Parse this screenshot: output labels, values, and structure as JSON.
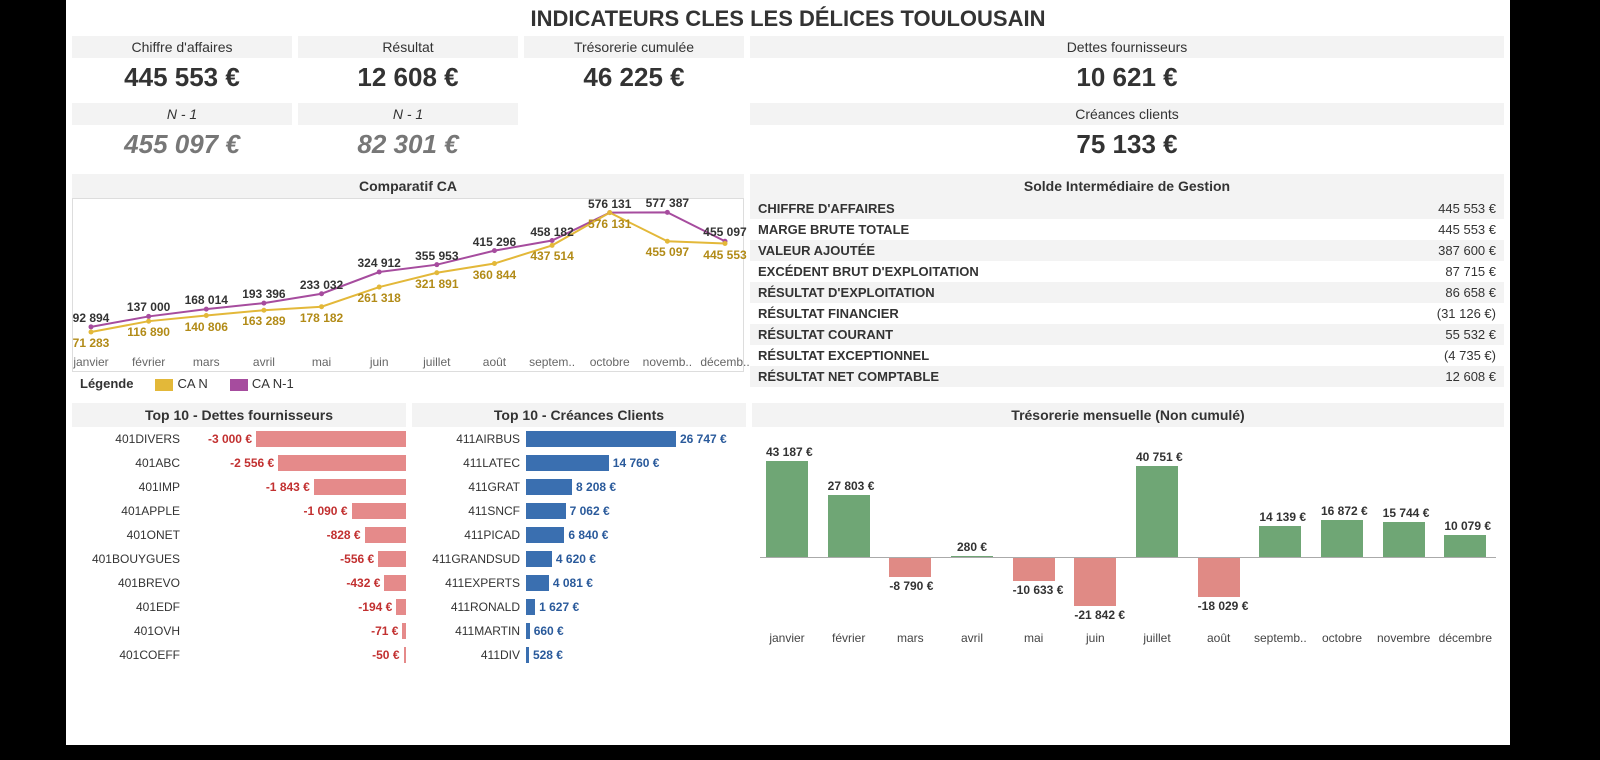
{
  "title": "INDICATEURS CLES LES DÉLICES TOULOUSAIN",
  "kpi_top": [
    {
      "label": "Chiffre d'affaires",
      "value": "445 553 €"
    },
    {
      "label": "Résultat",
      "value": "12 608 €"
    },
    {
      "label": "Trésorerie cumulée",
      "value": "46 225 €"
    },
    {
      "label": "Dettes fournisseurs",
      "value": "10 621 €"
    }
  ],
  "kpi_second": [
    {
      "label": "N - 1",
      "value": "455 097 €"
    },
    {
      "label": "N - 1",
      "value": "82 301 €"
    },
    {
      "label": "Créances clients",
      "value": "75 133 €"
    }
  ],
  "legend": {
    "title": "Légende",
    "a": "CA N",
    "b": "CA N-1"
  },
  "colors": {
    "can": "#e3b839",
    "can1": "#a64c9e",
    "red": "#e58a8a",
    "blue": "#3a6fb0",
    "green": "#6fa675",
    "salmon": "#e08a85"
  },
  "comparatif": {
    "title": "Comparatif CA",
    "months": [
      "janvier",
      "février",
      "mars",
      "avril",
      "mai",
      "juin",
      "juillet",
      "août",
      "septem..",
      "octobre",
      "novemb..",
      "décemb.."
    ]
  },
  "sig": {
    "title": "Solde Intermédiaire de Gestion",
    "rows": [
      {
        "l": "CHIFFRE D'AFFAIRES",
        "v": "445 553 €"
      },
      {
        "l": "MARGE BRUTE TOTALE",
        "v": "445 553 €"
      },
      {
        "l": "VALEUR AJOUTÉE",
        "v": "387 600 €"
      },
      {
        "l": "EXCÉDENT BRUT D'EXPLOITATION",
        "v": "87 715 €"
      },
      {
        "l": "RÉSULTAT D'EXPLOITATION",
        "v": "86 658 €"
      },
      {
        "l": "RÉSULTAT FINANCIER",
        "v": "(31 126 €)"
      },
      {
        "l": "RÉSULTAT COURANT",
        "v": "55 532 €"
      },
      {
        "l": "RÉSULTAT EXCEPTIONNEL",
        "v": "(4 735 €)"
      },
      {
        "l": "RÉSULTAT NET COMPTABLE",
        "v": "12 608 €"
      }
    ]
  },
  "dettes": {
    "title": "Top 10 - Dettes fournisseurs",
    "max": 3000,
    "rows": [
      {
        "c": "401DIVERS",
        "t": "-3 000 €",
        "v": 3000
      },
      {
        "c": "401ABC",
        "t": "-2 556 €",
        "v": 2556
      },
      {
        "c": "401IMP",
        "t": "-1 843 €",
        "v": 1843
      },
      {
        "c": "401APPLE",
        "t": "-1 090 €",
        "v": 1090
      },
      {
        "c": "401ONET",
        "t": "-828 €",
        "v": 828
      },
      {
        "c": "401BOUYGUES",
        "t": "-556 €",
        "v": 556
      },
      {
        "c": "401BREVO",
        "t": "-432 €",
        "v": 432
      },
      {
        "c": "401EDF",
        "t": "-194 €",
        "v": 194
      },
      {
        "c": "401OVH",
        "t": "-71 €",
        "v": 71
      },
      {
        "c": "401COEFF",
        "t": "-50 €",
        "v": 50
      }
    ]
  },
  "creances": {
    "title": "Top 10 - Créances Clients",
    "max": 26747,
    "rows": [
      {
        "c": "411AIRBUS",
        "t": "26 747 €",
        "v": 26747
      },
      {
        "c": "411LATEC",
        "t": "14 760 €",
        "v": 14760
      },
      {
        "c": "411GRAT",
        "t": "8 208 €",
        "v": 8208
      },
      {
        "c": "411SNCF",
        "t": "7 062 €",
        "v": 7062
      },
      {
        "c": "411PICAD",
        "t": "6 840 €",
        "v": 6840
      },
      {
        "c": "411GRANDSUD",
        "t": "4 620 €",
        "v": 4620
      },
      {
        "c": "411EXPERTS",
        "t": "4 081 €",
        "v": 4081
      },
      {
        "c": "411RONALD",
        "t": "1 627 €",
        "v": 1627
      },
      {
        "c": "411MARTIN",
        "t": "660 €",
        "v": 660
      },
      {
        "c": "411DIV",
        "t": "528 €",
        "v": 528
      }
    ]
  },
  "treso": {
    "title": "Trésorerie mensuelle (Non cumulé)",
    "months": [
      "janvier",
      "février",
      "mars",
      "avril",
      "mai",
      "juin",
      "juillet",
      "août",
      "septemb..",
      "octobre",
      "novembre",
      "décembre"
    ],
    "values": [
      43187,
      27803,
      -8790,
      280,
      -10633,
      -21842,
      40751,
      -18029,
      14139,
      16872,
      15744,
      10079
    ],
    "labels": [
      "43 187 €",
      "27 803 €",
      "-8 790 €",
      "280 €",
      "-10 633 €",
      "-21 842 €",
      "40 751 €",
      "-18 029 €",
      "14 139 €",
      "16 872 €",
      "15 744 €",
      "10 079 €"
    ]
  },
  "chart_data": [
    {
      "type": "line",
      "title": "Comparatif CA",
      "xlabel": "",
      "ylabel": "",
      "categories": [
        "janvier",
        "février",
        "mars",
        "avril",
        "mai",
        "juin",
        "juillet",
        "août",
        "septembre",
        "octobre",
        "novembre",
        "décembre"
      ],
      "series": [
        {
          "name": "CA N",
          "values": [
            71283,
            116890,
            140806,
            163289,
            178182,
            261318,
            321891,
            360844,
            437514,
            576131,
            455097,
            445553
          ]
        },
        {
          "name": "CA N-1",
          "values": [
            92894,
            137000,
            168014,
            193396,
            233032,
            324912,
            355953,
            415296,
            458182,
            576131,
            577387,
            455097
          ]
        }
      ],
      "ylim": [
        0,
        600000
      ]
    },
    {
      "type": "bar",
      "orientation": "horizontal",
      "title": "Top 10 - Dettes fournisseurs",
      "categories": [
        "401DIVERS",
        "401ABC",
        "401IMP",
        "401APPLE",
        "401ONET",
        "401BOUYGUES",
        "401BREVO",
        "401EDF",
        "401OVH",
        "401COEFF"
      ],
      "values": [
        -3000,
        -2556,
        -1843,
        -1090,
        -828,
        -556,
        -432,
        -194,
        -71,
        -50
      ]
    },
    {
      "type": "bar",
      "orientation": "horizontal",
      "title": "Top 10 - Créances Clients",
      "categories": [
        "411AIRBUS",
        "411LATEC",
        "411GRAT",
        "411SNCF",
        "411PICAD",
        "411GRANDSUD",
        "411EXPERTS",
        "411RONALD",
        "411MARTIN",
        "411DIV"
      ],
      "values": [
        26747,
        14760,
        8208,
        7062,
        6840,
        4620,
        4081,
        1627,
        660,
        528
      ]
    },
    {
      "type": "bar",
      "title": "Trésorerie mensuelle (Non cumulé)",
      "categories": [
        "janvier",
        "février",
        "mars",
        "avril",
        "mai",
        "juin",
        "juillet",
        "août",
        "septembre",
        "octobre",
        "novembre",
        "décembre"
      ],
      "values": [
        43187,
        27803,
        -8790,
        280,
        -10633,
        -21842,
        40751,
        -18029,
        14139,
        16872,
        15744,
        10079
      ]
    }
  ]
}
